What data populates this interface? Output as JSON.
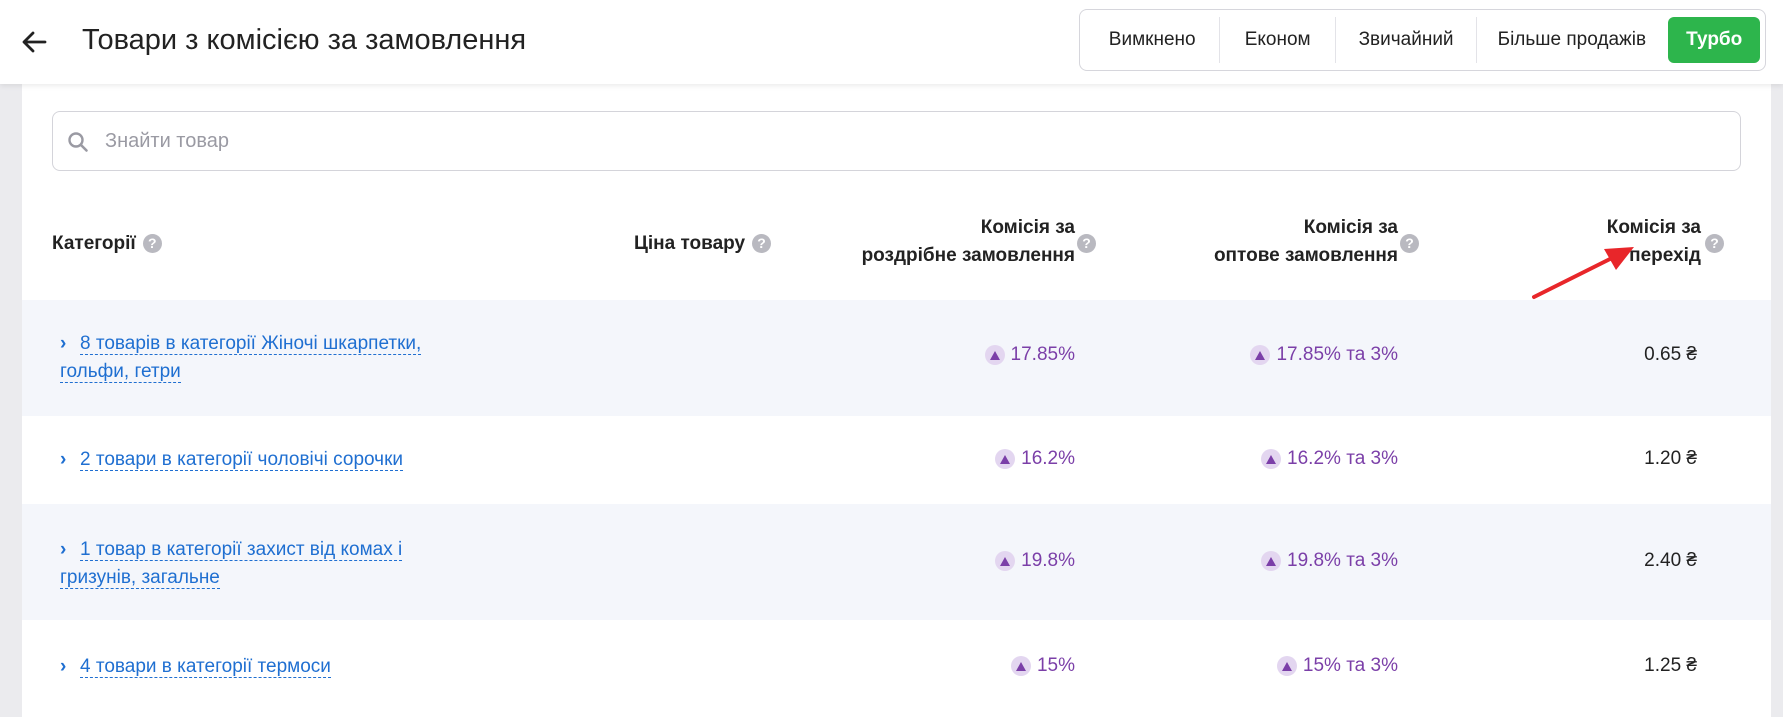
{
  "header": {
    "title": "Товари з комісією за замовлення",
    "modes": [
      "Вимкнено",
      "Економ",
      "Звичайний",
      "Більше продажів",
      "Турбо"
    ],
    "active_mode": "Турбо"
  },
  "search": {
    "placeholder": "Знайти товар"
  },
  "table": {
    "columns": {
      "category": "Категорії",
      "price": "Ціна товару",
      "retail_line1": "Комісія за",
      "retail_line2": "роздрібне замовлення",
      "wholesale_line1": "Комісія за",
      "wholesale_line2": "оптове замовлення",
      "click_line1": "Комісія за",
      "click_line2": "перехід"
    },
    "rows": [
      {
        "category_line1": "8 товарів в категорії Жіночі шкарпетки,",
        "category_line2": "гольфи, гетри",
        "retail": "17.85%",
        "wholesale": "17.85% та 3%",
        "click": "0.65 ₴"
      },
      {
        "category_line1": "2 товари в категорії чоловічі сорочки",
        "retail": "16.2%",
        "wholesale": "16.2% та 3%",
        "click": "1.20 ₴"
      },
      {
        "category_line1": "1 товар в категорії захист від комах і",
        "category_line2": "гризунів, загальне",
        "retail": "19.8%",
        "wholesale": "19.8% та 3%",
        "click": "2.40 ₴"
      },
      {
        "category_line1": "4 товари в категорії термоси",
        "retail": "15%",
        "wholesale": "15% та 3%",
        "click": "1.25 ₴"
      }
    ]
  },
  "colors": {
    "turbo_active": "#2db54c",
    "link": "#1f6fd1",
    "commission": "#7b3fa8",
    "annotation_arrow": "#e8262a"
  },
  "icons": {
    "back": "arrow-left-icon",
    "search": "search-icon",
    "help": "question-circle-icon",
    "expand": "chevron-right-icon",
    "commission_up": "triangle-up-icon"
  }
}
